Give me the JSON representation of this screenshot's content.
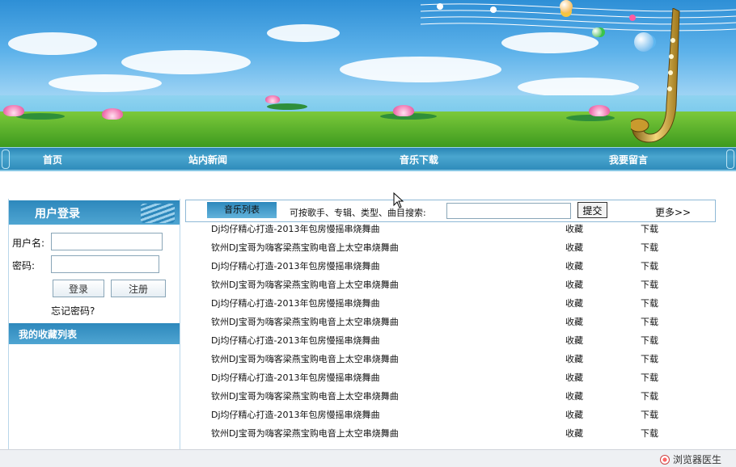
{
  "nav": {
    "items": [
      {
        "label": "首页"
      },
      {
        "label": "站内新闻"
      },
      {
        "label": "音乐下载"
      },
      {
        "label": "我要留言"
      }
    ]
  },
  "login": {
    "title": "用户登录",
    "username_label": "用户名:",
    "password_label": "密码:",
    "username_value": "",
    "password_value": "",
    "login_button": "登录",
    "register_button": "注册",
    "forgot": "忘记密码?"
  },
  "favorites": {
    "title": "我的收藏列表"
  },
  "music": {
    "tab_label": "音乐列表",
    "search_label": "可按歌手、专辑、类型、曲目搜索:",
    "search_value": "",
    "submit": "提交",
    "more": "更多>>",
    "songs": [
      {
        "title": "Dj均仔精心打造-2013年包房慢摇串烧舞曲",
        "fav": "收藏",
        "download": "下载"
      },
      {
        "title": "钦州DJ宝哥为嗨客梁燕宝购电音上太空串烧舞曲",
        "fav": "收藏",
        "download": "下载"
      },
      {
        "title": "Dj均仔精心打造-2013年包房慢摇串烧舞曲",
        "fav": "收藏",
        "download": "下载"
      },
      {
        "title": "钦州DJ宝哥为嗨客梁燕宝购电音上太空串烧舞曲",
        "fav": "收藏",
        "download": "下载"
      },
      {
        "title": "Dj均仔精心打造-2013年包房慢摇串烧舞曲",
        "fav": "收藏",
        "download": "下载"
      },
      {
        "title": "钦州DJ宝哥为嗨客梁燕宝购电音上太空串烧舞曲",
        "fav": "收藏",
        "download": "下载"
      },
      {
        "title": "Dj均仔精心打造-2013年包房慢摇串烧舞曲",
        "fav": "收藏",
        "download": "下载"
      },
      {
        "title": "钦州DJ宝哥为嗨客梁燕宝购电音上太空串烧舞曲",
        "fav": "收藏",
        "download": "下载"
      },
      {
        "title": "Dj均仔精心打造-2013年包房慢摇串烧舞曲",
        "fav": "收藏",
        "download": "下载"
      },
      {
        "title": "钦州DJ宝哥为嗨客梁燕宝购电音上太空串烧舞曲",
        "fav": "收藏",
        "download": "下载"
      },
      {
        "title": "Dj均仔精心打造-2013年包房慢摇串烧舞曲",
        "fav": "收藏",
        "download": "下载"
      },
      {
        "title": "钦州DJ宝哥为嗨客梁燕宝购电音上太空串烧舞曲",
        "fav": "收藏",
        "download": "下载"
      }
    ]
  },
  "statusbar": {
    "doctor": "浏览器医生"
  },
  "colors": {
    "nav_bar": "#2f8cbb",
    "panel_header": "#2d88bc",
    "sky": "#5db2ea",
    "grass": "#3d9a1e"
  }
}
